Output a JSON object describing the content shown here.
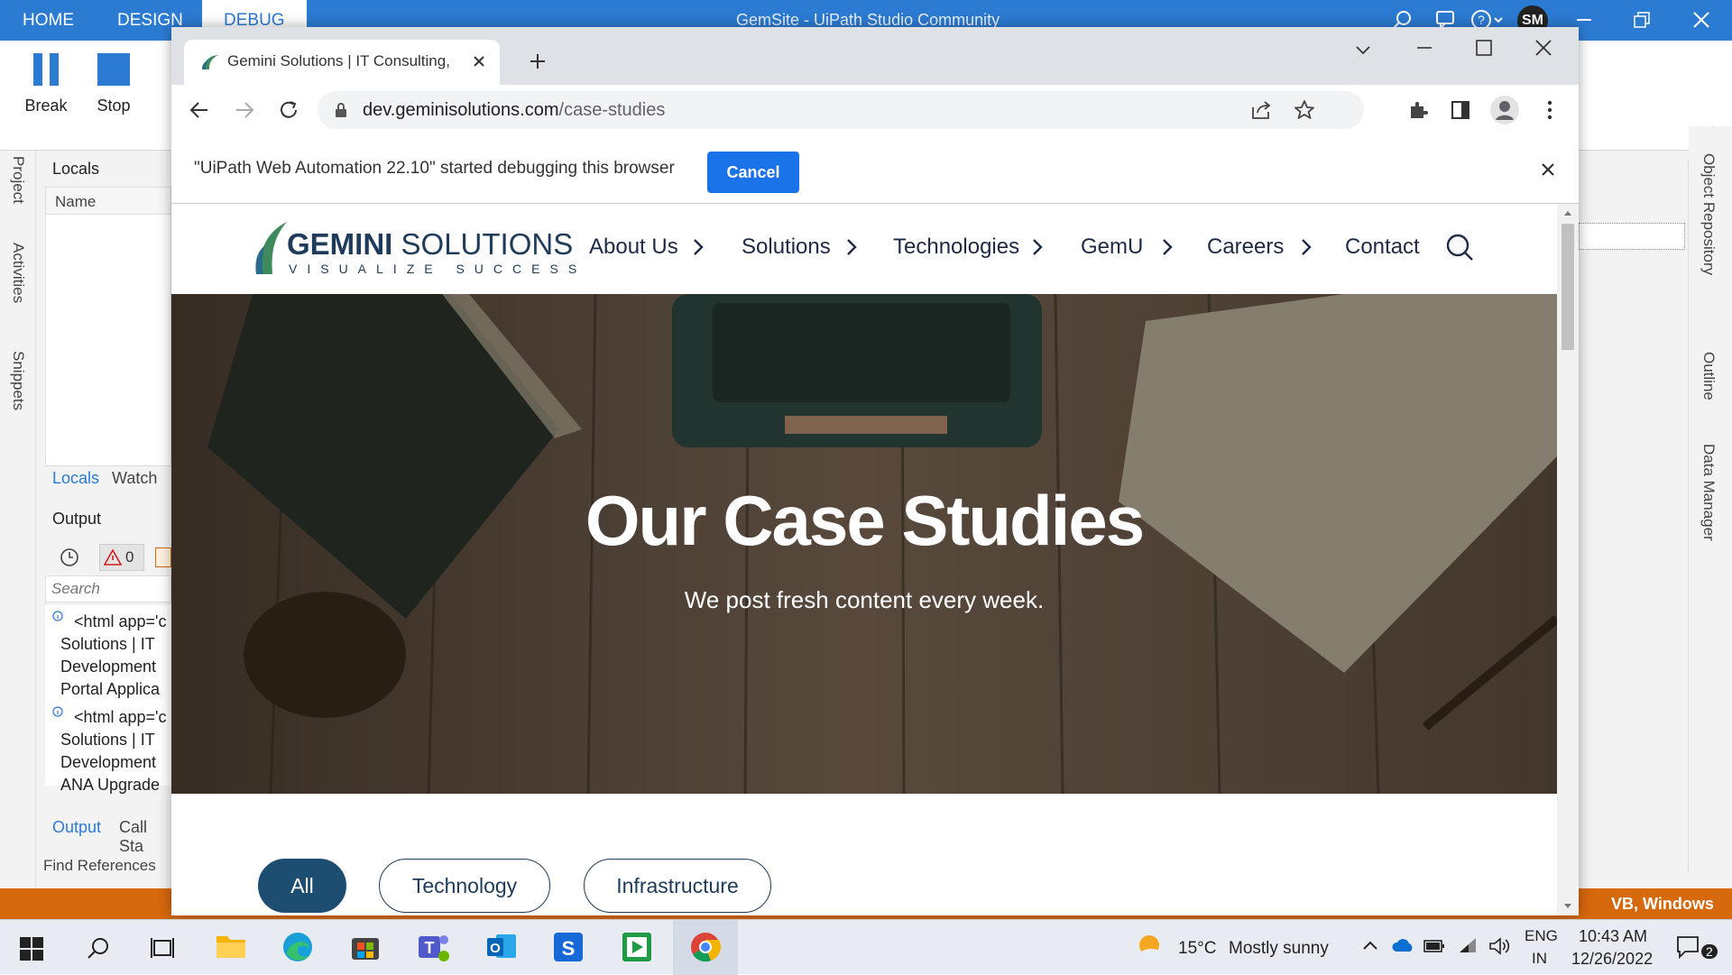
{
  "studio": {
    "tabs": [
      "HOME",
      "DESIGN",
      "DEBUG"
    ],
    "title": "GemSite - UiPath Studio Community",
    "user_initials": "SM",
    "ribbon": {
      "break_label": "Break",
      "stop_label": "Stop"
    },
    "left_rail": [
      "Project",
      "Activities",
      "Snippets"
    ],
    "locals_panel": {
      "title": "Locals",
      "column_name": "Name",
      "tab_locals": "Locals",
      "tab_watch": "Watch"
    },
    "output_panel": {
      "title": "Output",
      "error_count": "0",
      "search_placeholder": "Search",
      "entries": [
        {
          "lines": [
            "<html app='c",
            "Solutions | IT",
            "Development",
            "Portal Applica"
          ]
        },
        {
          "lines": [
            "<html app='c",
            "Solutions | IT",
            "Development",
            "ANA Upgrade"
          ]
        }
      ],
      "tab_output": "Output",
      "tab_callstack": "Call Sta"
    },
    "find_references": "Find References",
    "right_rail": [
      "Object Repository",
      "Outline",
      "Data Manager"
    ],
    "status_right": "VB, Windows"
  },
  "browser": {
    "tab_title": "Gemini Solutions | IT Consulting,",
    "url_host": "dev.geminisolutions.com",
    "url_path": "/case-studies",
    "infobar_message": "\"UiPath Web Automation 22.10\" started debugging this browser",
    "cancel_label": "Cancel"
  },
  "site": {
    "logo_main_1": "GEMINI",
    "logo_main_2": " SOLUTIONS",
    "logo_tagline": "VISUALIZE SUCCESS",
    "nav": [
      "About Us",
      "Solutions",
      "Technologies",
      "GemU",
      "Careers",
      "Contact"
    ],
    "hero_title": "Our Case Studies",
    "hero_subtitle": "We post fresh content every week.",
    "filters": [
      "All",
      "Technology",
      "Infrastructure"
    ],
    "active_filter": "All",
    "colors": {
      "navy": "#1e2a45",
      "filter_active": "#1e4d72",
      "logo_green": "#3f8a5c"
    }
  },
  "taskbar": {
    "weather_temp": "15°C",
    "weather_desc": "Mostly sunny",
    "lang_1": "ENG",
    "lang_2": "IN",
    "time": "10:43 AM",
    "date": "12/26/2022",
    "notification_count": "2"
  }
}
